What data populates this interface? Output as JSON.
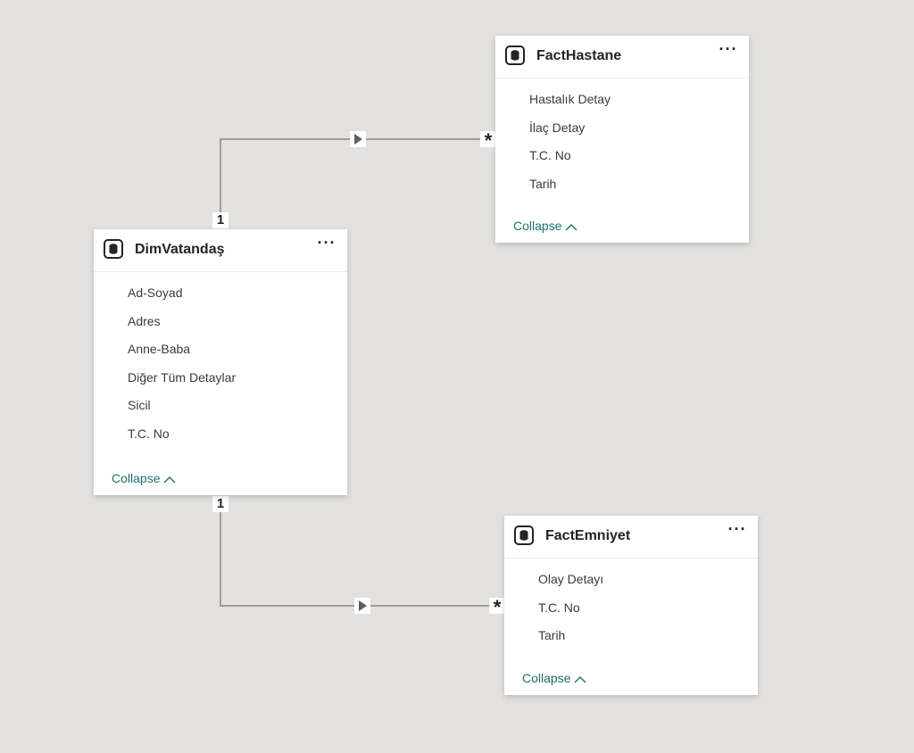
{
  "tables": {
    "factHastane": {
      "title": "FactHastane",
      "fields": [
        "Hastalık Detay",
        "İlaç Detay",
        "T.C. No",
        "Tarih"
      ],
      "collapse_label": "Collapse"
    },
    "dimVatandas": {
      "title": "DimVatandaş",
      "fields": [
        "Ad-Soyad",
        "Adres",
        "Anne-Baba",
        "Diğer Tüm Detaylar",
        "Sicil",
        "T.C. No"
      ],
      "collapse_label": "Collapse"
    },
    "factEmniyet": {
      "title": "FactEmniyet",
      "fields": [
        "Olay Detayı",
        "T.C. No",
        "Tarih"
      ],
      "collapse_label": "Collapse"
    }
  },
  "more_label": "···",
  "relationships": [
    {
      "from_label": "1",
      "to_label": "*"
    },
    {
      "from_label": "1",
      "to_label": "*"
    }
  ],
  "colors": {
    "background": "#e2e1df",
    "line": "#8a8886",
    "accent": "#1f6f6e",
    "text": "#252423"
  },
  "icons": {
    "table": "database-table-icon",
    "more": "more-options-icon",
    "collapse": "chevron-up-icon",
    "direction": "filter-direction-arrow-icon"
  }
}
